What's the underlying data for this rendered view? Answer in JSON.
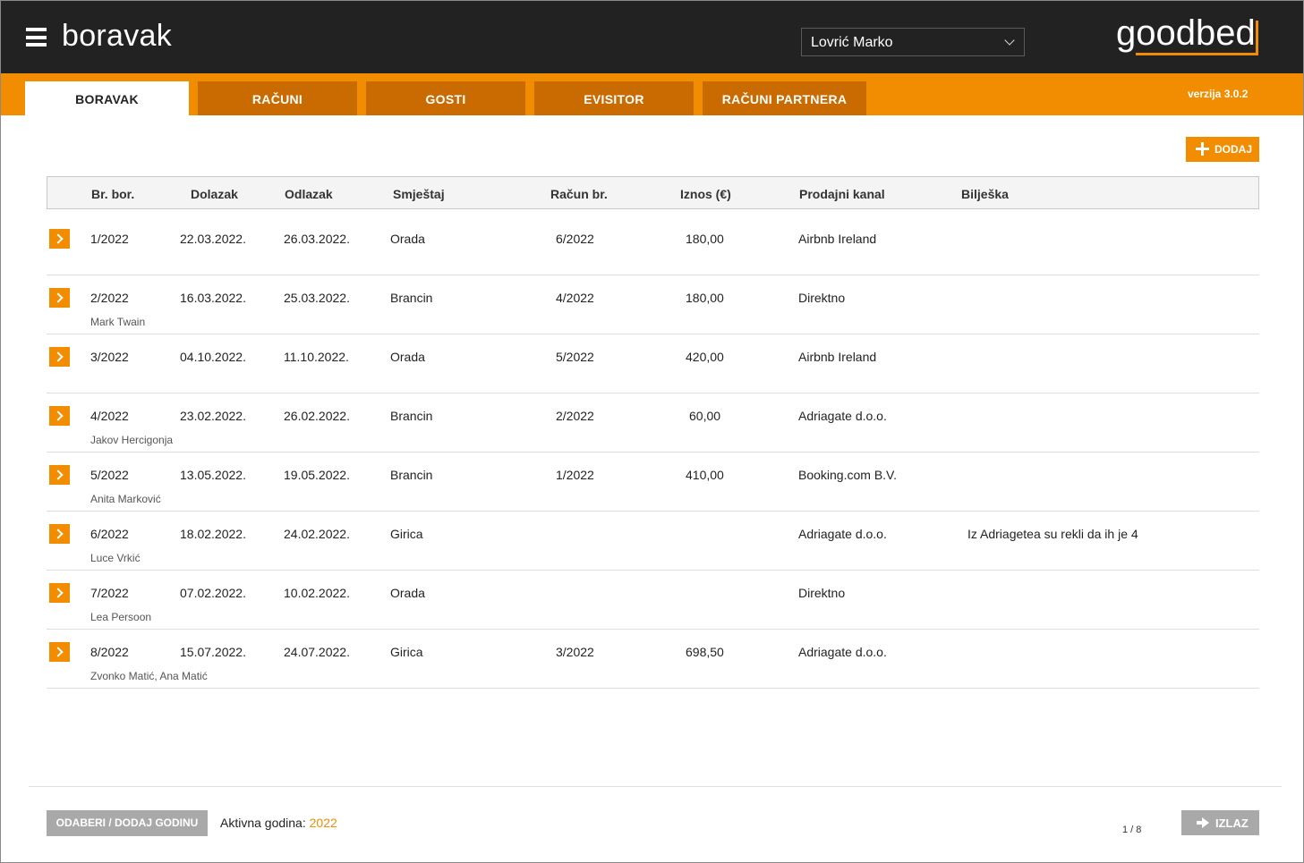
{
  "header": {
    "menu_icon": "hamburger-menu-icon",
    "title": "boravak",
    "user_select_value": "Lovrić Marko",
    "logo_text": "goodbed"
  },
  "tabs": [
    {
      "label": "BORAVAK",
      "active": true
    },
    {
      "label": "RAČUNI",
      "active": false
    },
    {
      "label": "GOSTI",
      "active": false
    },
    {
      "label": "EVISITOR",
      "active": false
    },
    {
      "label": "RAČUNI PARTNERA",
      "active": false
    }
  ],
  "version": "verzija 3.0.2",
  "toolbar": {
    "add_label": "DODAJ",
    "add_icon": "plus-icon"
  },
  "table": {
    "columns": [
      "Br. bor.",
      "Dolazak",
      "Odlazak",
      "Smještaj",
      "Račun br.",
      "Iznos (€)",
      "Prodajni kanal",
      "Bilješka"
    ],
    "rows": [
      {
        "br": "1/2022",
        "dolazak": "22.03.2022.",
        "odlazak": "26.03.2022.",
        "smjestaj": "Orada",
        "racun": "6/2022",
        "iznos": "180,00",
        "kanal": "Airbnb Ireland",
        "biljeska": "",
        "gost": ""
      },
      {
        "br": "2/2022",
        "dolazak": "16.03.2022.",
        "odlazak": "25.03.2022.",
        "smjestaj": "Brancin",
        "racun": "4/2022",
        "iznos": "180,00",
        "kanal": "Direktno",
        "biljeska": "",
        "gost": "Mark Twain"
      },
      {
        "br": "3/2022",
        "dolazak": "04.10.2022.",
        "odlazak": "11.10.2022.",
        "smjestaj": "Orada",
        "racun": "5/2022",
        "iznos": "420,00",
        "kanal": "Airbnb Ireland",
        "biljeska": "",
        "gost": ""
      },
      {
        "br": "4/2022",
        "dolazak": "23.02.2022.",
        "odlazak": "26.02.2022.",
        "smjestaj": "Brancin",
        "racun": "2/2022",
        "iznos": "60,00",
        "kanal": "Adriagate d.o.o.",
        "biljeska": "",
        "gost": "Jakov Hercigonja"
      },
      {
        "br": "5/2022",
        "dolazak": "13.05.2022.",
        "odlazak": "19.05.2022.",
        "smjestaj": "Brancin",
        "racun": "1/2022",
        "iznos": "410,00",
        "kanal": "Booking.com B.V.",
        "biljeska": "",
        "gost": "Anita Marković"
      },
      {
        "br": "6/2022",
        "dolazak": "18.02.2022.",
        "odlazak": "24.02.2022.",
        "smjestaj": "Girica",
        "racun": "",
        "iznos": "",
        "kanal": "Adriagate d.o.o.",
        "biljeska": "Iz Adriagetea su rekli da ih je 4",
        "gost": "Luce Vrkić"
      },
      {
        "br": "7/2022",
        "dolazak": "07.02.2022.",
        "odlazak": "10.02.2022.",
        "smjestaj": "Orada",
        "racun": "",
        "iznos": "",
        "kanal": "Direktno",
        "biljeska": "",
        "gost": "Lea Persoon"
      },
      {
        "br": "8/2022",
        "dolazak": "15.07.2022.",
        "odlazak": "24.07.2022.",
        "smjestaj": "Girica",
        "racun": "3/2022",
        "iznos": "698,50",
        "kanal": "Adriagate d.o.o.",
        "biljeska": "",
        "gost": "Zvonko Matić, Ana Matić"
      }
    ]
  },
  "footer": {
    "year_button_label": "ODABERI / DODAJ GODINU",
    "active_year_label": "Aktivna godina: ",
    "active_year": "2022",
    "pager": "1 / 8",
    "exit_label": "IZLAZ",
    "exit_icon": "arrow-right-icon"
  },
  "colors": {
    "header_bg": "#222222",
    "accent": "#f28c00",
    "tab_inactive": "#c96b00",
    "button_gray": "#a9a9a9"
  }
}
